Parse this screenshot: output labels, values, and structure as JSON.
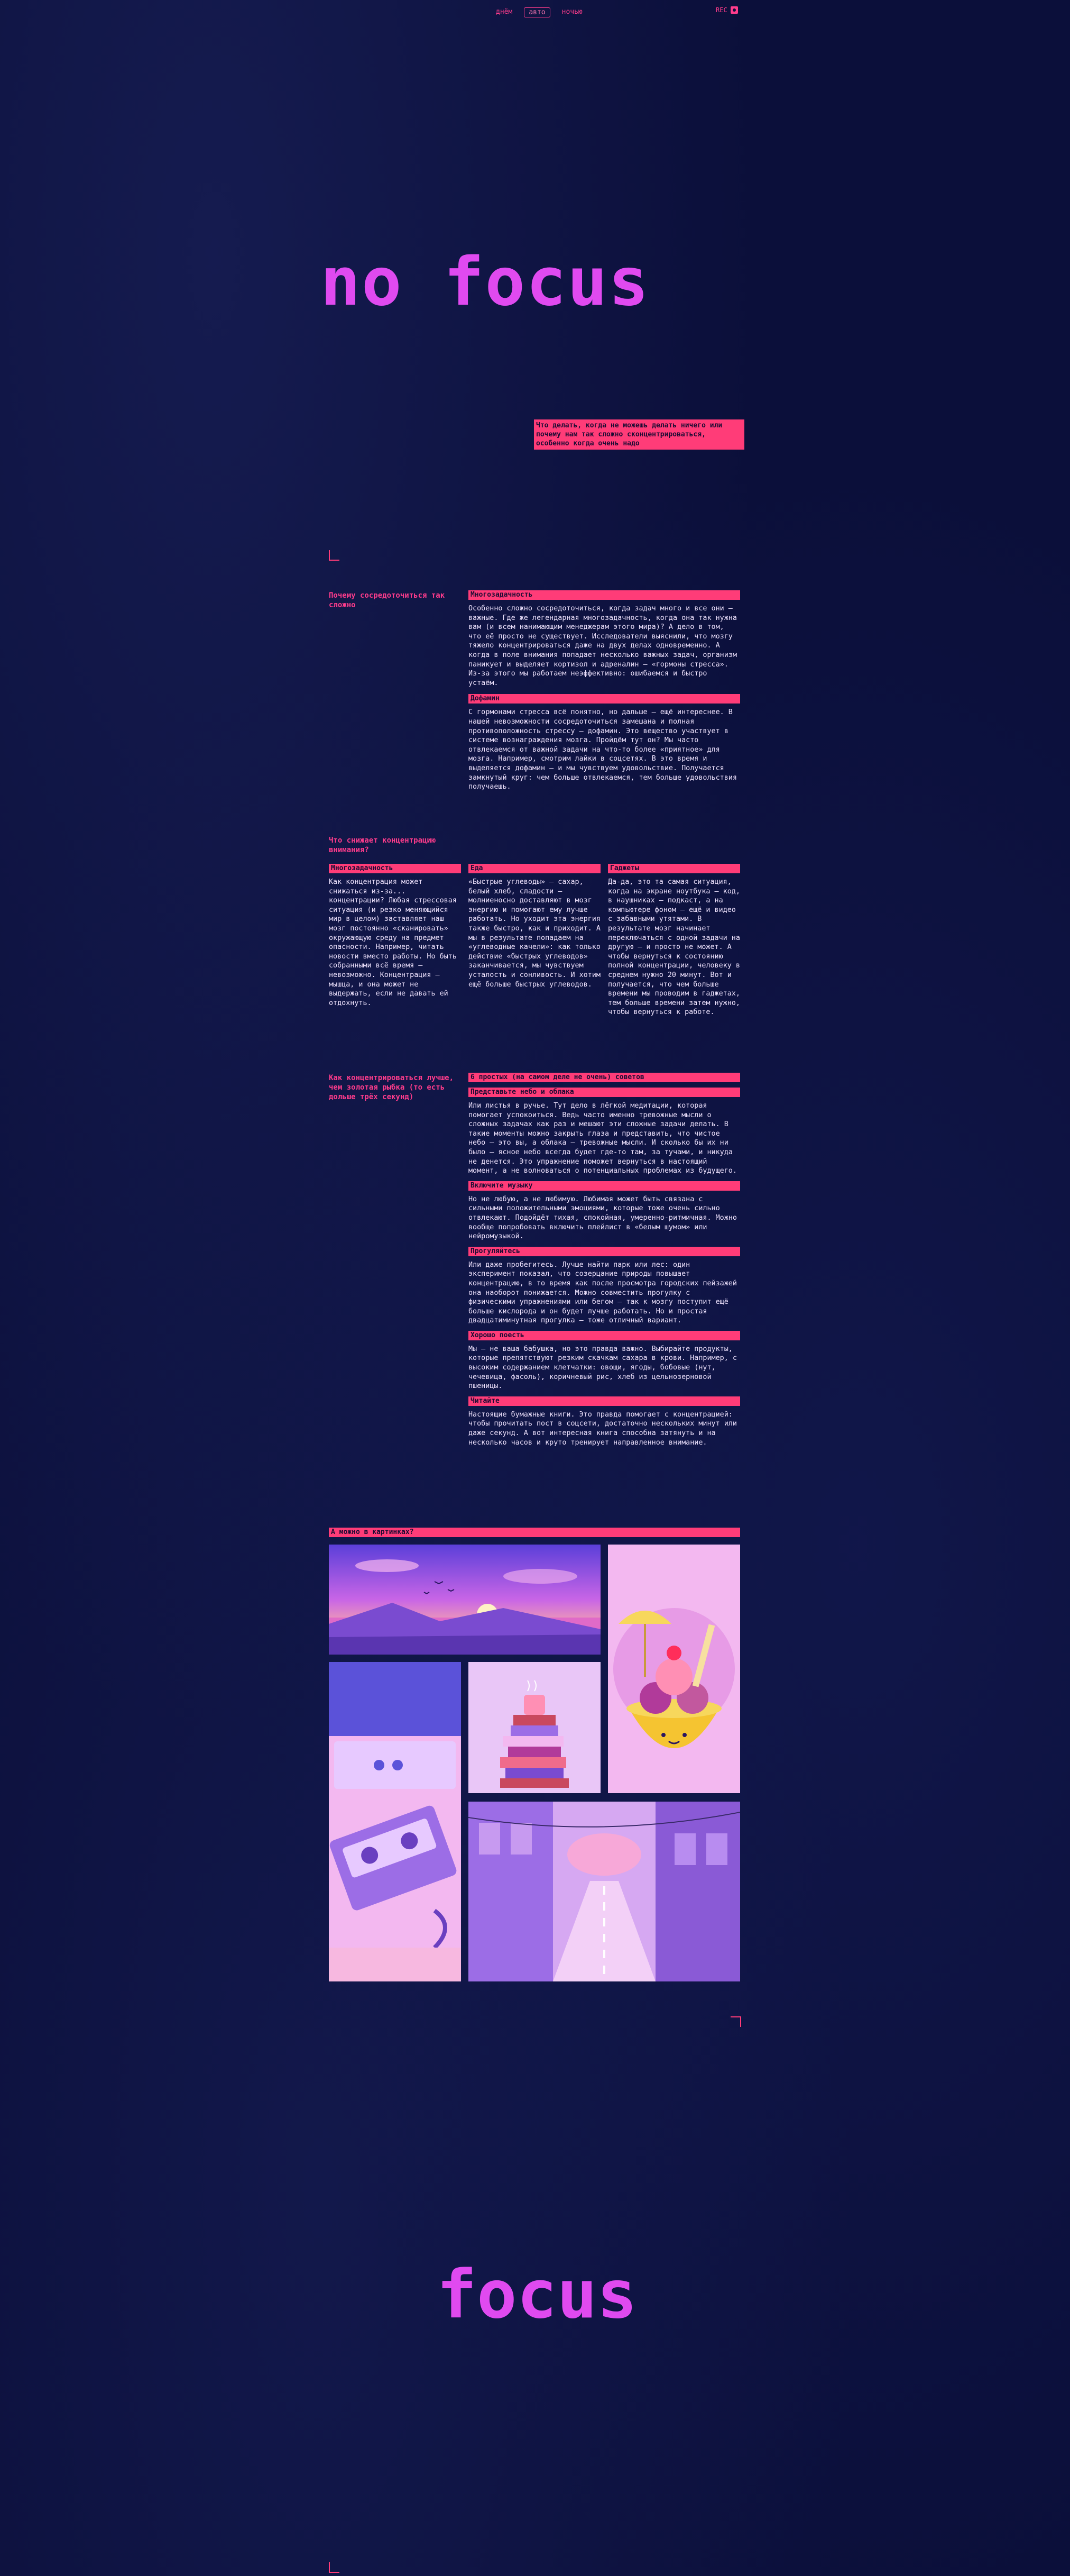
{
  "nav": {
    "items": [
      "днём",
      "авто",
      "ночью"
    ],
    "active": 1,
    "rec": "REC"
  },
  "hero": {
    "title": "no focus",
    "intro": "Что делать, когда не можешь делать ничего или почему нам так сложно сконцентрироваться, особенно когда очень надо"
  },
  "section1": {
    "question": "Почему сосредоточиться так сложно",
    "blocks": [
      {
        "title": "Многозадачность",
        "text": "Особенно сложно сосредоточиться, когда задач много и все они — важные. Где же легендарная многозадачность, когда она так нужна вам (и всем нанимающим менеджерам этого мира)? А дело в том, что её просто не существует. Исследователи выяснили, что мозгу тяжело концентрироваться даже на двух делах одновременно. А когда в поле внимания попадает несколько важных задач, организм паникует и выделяет кортизол и адреналин — «гормоны стресса». Из-за этого мы работаем неэффективно: ошибаемся и быстро устаём."
      },
      {
        "title": "Дофамин",
        "text": "С гормонами стресса всё понятно, но дальше — ещё интереснее. В нашей невозможности сосредоточиться замешана и полная противоположность стрессу — дофамин. Это вещество участвует в системе вознаграждения мозга. Пройдём тут он? Мы часто отвлекаемся от важной задачи на что-то более «приятное» для мозга. Например, смотрим лайки в соцсетях. В это время и выделяется дофамин — и мы чувствуем удовольствие. Получается замкнутый круг: чем больше отвлекаемся, тем больше удовольствия получаешь."
      }
    ]
  },
  "section2": {
    "question": "Что снижает концентрацию внимания?",
    "columns": [
      {
        "title": "Многозадачность",
        "text": "Как концентрация может снижаться из-за... концентрации? Любая стрессовая ситуация (и резко меняющийся мир в целом) заставляет наш мозг постоянно «сканировать» окружающую среду на предмет опасности. Например, читать новости вместо работы. Но быть собранными всё время — невозможно. Концентрация — мышца, и она может не выдержать, если не давать ей отдохнуть."
      },
      {
        "title": "Еда",
        "text": "«Быстрые углеводы» — сахар, белый хлеб, сладости — молниеносно доставляют в мозг энергию и помогают ему лучше работать. Но уходит эта энергия также быстро, как и приходит. А мы в результате попадаем на «углеводные качели»: как только действие «быстрых углеводов» заканчивается, мы чувствуем усталость и сонливость. И хотим ещё больше быстрых углеводов."
      },
      {
        "title": "Гаджеты",
        "text": "Да-да, это та самая ситуация, когда на экране ноутбука — код, в наушниках — подкаст, а на компьютере фоном — ещё и видео с забавными утятами. В результате мозг начинает переключаться с одной задачи на другую — и просто не может. А чтобы вернуться к состоянию полной концентрации, человеку в среднем нужно 20 минут. Вот и получается, что чем больше времени мы проводим в гаджетах, тем больше времени затем нужно, чтобы вернуться к работе."
      }
    ]
  },
  "section3": {
    "question": "Как концентрироваться лучше, чем золотая рыбка (то есть дольше трёх секунд)",
    "lead": "6 простых (на самом деле не очень) советов",
    "tips": [
      {
        "title": "Представьте небо и облака",
        "text": "Или листья в ручье. Тут дело в лёгкой медитации, которая помогает успокоиться. Ведь часто именно тревожные мысли о сложных задачах как раз и мешают эти сложные задачи делать. В такие моменты можно закрыть глаза и представить, что чистое небо — это вы, а облака — тревожные мысли. И сколько бы их ни было — ясное небо всегда будет где-то там, за тучами, и никуда не денется. Это упражнение поможет вернуться в настоящий момент, а не волноваться о потенциальных проблемах из будущего."
      },
      {
        "title": "Включите музыку",
        "text": "Но не любую, а не любимую. Любимая может быть связана с сильными положительными эмоциями, которые тоже очень сильно отвлекают. Подойдёт тихая, спокойная, умеренно-ритмичная. Можно вообще попробовать включить плейлист в «белым шумом» или нейромузыкой."
      },
      {
        "title": "Прогуляйтесь",
        "text": "Или даже пробегитесь. Лучше найти парк или лес: один эксперимент показал, что созерцание природы повышает концентрацию, в то время как после просмотра городских пейзажей она наоборот понижается. Можно совместить прогулку с физическими упражнениями или бегом — так к мозгу поступит ещё больше кислорода и он будет лучше работать. Но и простая двадцатиминутная прогулка — тоже отличный вариант."
      },
      {
        "title": "Хорошо поесть",
        "text": "Мы — не ваша бабушка, но это правда важно. Выбирайте продукты, которые препятствуют резким скачкам сахара в крови. Например, с высоким содержанием клетчатки: овощи, ягоды, бобовые (нут, чечевица, фасоль), коричневый рис, хлеб из цельнозерновой пшеницы."
      },
      {
        "title": "Читайте",
        "text": "Настоящие бумажные книги. Это правда помогает с концентрацией: чтобы прочитать пост в соцсети, достаточно нескольких минут или даже секунд. А вот интересная книга способна затянуть и на несколько часов и круто тренирует направленное внимание."
      }
    ]
  },
  "gallery": {
    "title": "А можно в картинках?"
  },
  "footer": {
    "title": "focus"
  },
  "colors": {
    "bg": "#0b0f3a",
    "accent": "#ff3c78",
    "title": "#e04af0"
  }
}
